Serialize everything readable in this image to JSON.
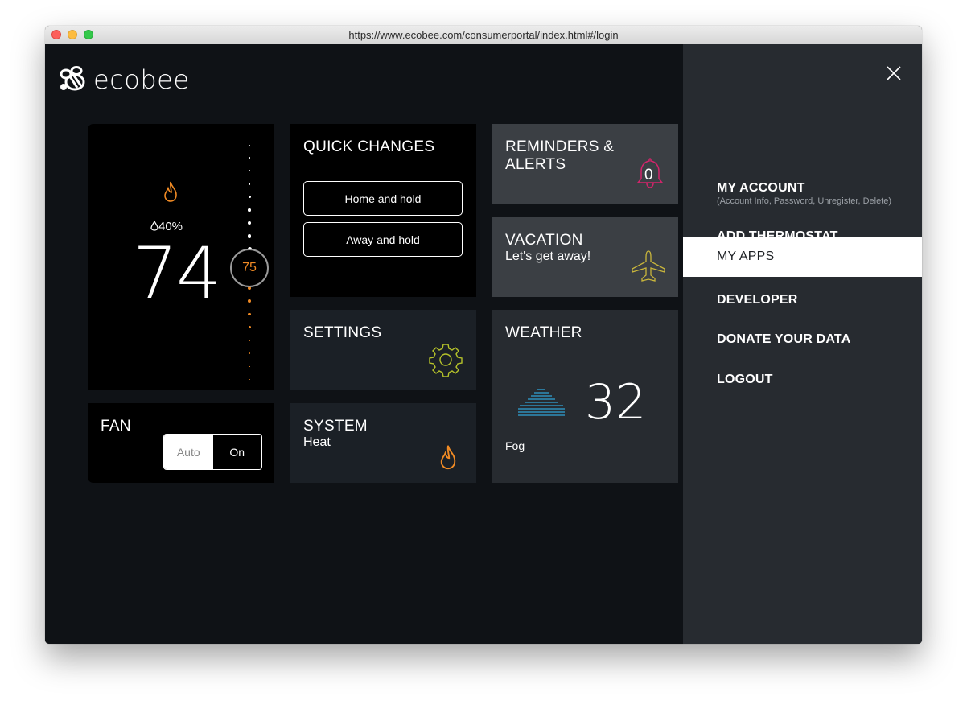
{
  "browser": {
    "url": "https://www.ecobee.com/consumerportal/index.html#/login"
  },
  "logo": {
    "text": "ecobee",
    "icon": "bee-icon"
  },
  "thermostat": {
    "humidity": "40%",
    "current_temp": "74",
    "setpoint": "75",
    "mode_icon": "flame-icon",
    "colors": {
      "heat": "#f08a24",
      "cool": "#ffffff"
    }
  },
  "fan": {
    "title": "FAN",
    "options": [
      "Auto",
      "On"
    ],
    "selected": "Auto"
  },
  "quick_changes": {
    "title": "QUICK CHANGES",
    "buttons": [
      "Home and hold",
      "Away and hold"
    ]
  },
  "settings": {
    "title": "SETTINGS",
    "icon": "gear-icon"
  },
  "system": {
    "title": "SYSTEM",
    "mode": "Heat",
    "icon": "flame-icon"
  },
  "reminders": {
    "title_line1": "REMINDERS &",
    "title_line2": "ALERTS",
    "count": "0",
    "icon": "bell-icon"
  },
  "vacation": {
    "title": "VACATION",
    "subtitle": "Let's get away!",
    "icon": "airplane-icon"
  },
  "weather": {
    "title": "WEATHER",
    "temp": "32",
    "condition": "Fog",
    "icon": "fog-icon"
  },
  "menu": {
    "close_icon": "close-icon",
    "items": [
      {
        "label": "MY ACCOUNT",
        "sub": "(Account Info, Password, Unregister, Delete)"
      },
      {
        "label": "ADD THERMOSTAT"
      },
      {
        "label": "MY APPS",
        "active": true
      },
      {
        "label": "DEVELOPER"
      },
      {
        "label": "DONATE YOUR DATA"
      },
      {
        "label": "LOGOUT"
      }
    ]
  }
}
